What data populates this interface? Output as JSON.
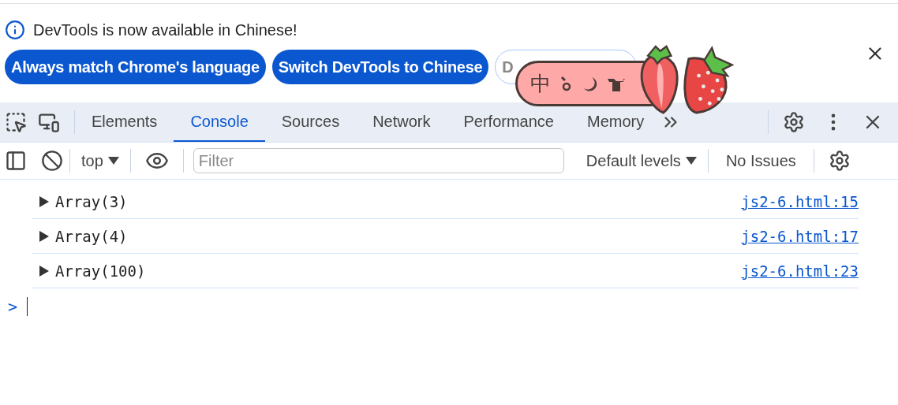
{
  "infobar": {
    "message": "DevTools is now available in Chinese!",
    "buttons": [
      {
        "label": "Always match Chrome's language",
        "kind": "primary"
      },
      {
        "label": "Switch DevTools to Chinese",
        "kind": "primary"
      },
      {
        "label": "D",
        "kind": "outline"
      }
    ]
  },
  "tabs": [
    {
      "label": "Elements",
      "selected": false
    },
    {
      "label": "Console",
      "selected": true
    },
    {
      "label": "Sources",
      "selected": false
    },
    {
      "label": "Network",
      "selected": false
    },
    {
      "label": "Performance",
      "selected": false
    },
    {
      "label": "Memory",
      "selected": false
    }
  ],
  "toolbar": {
    "context": "top",
    "filter": {
      "placeholder": "Filter"
    },
    "levels": "Default levels",
    "issues": "No Issues"
  },
  "messages": [
    {
      "text": "Array(3)",
      "source": "js2-6.html:15"
    },
    {
      "text": "Array(4)",
      "source": "js2-6.html:17"
    },
    {
      "text": "Array(100)",
      "source": "js2-6.html:23"
    }
  ],
  "prompt": ">",
  "ime": {
    "label": "中"
  }
}
